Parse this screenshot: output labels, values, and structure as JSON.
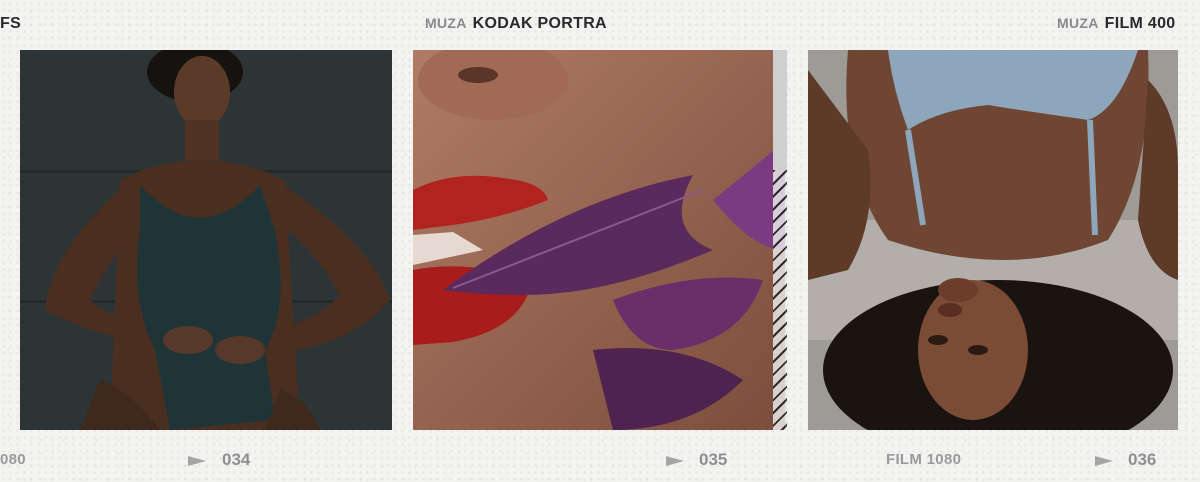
{
  "frames": [
    {
      "top_brand": "",
      "top_title": "FS",
      "bottom_label": "080",
      "frame_number": "034",
      "photo_alt": "woman in dark green swimsuit, hands on hips"
    },
    {
      "top_brand": "MUZA",
      "top_title": "KODAK PORTRA",
      "bottom_label": "",
      "frame_number": "035",
      "photo_alt": "close-up of red lips with purple leaf"
    },
    {
      "top_brand": "MUZA",
      "top_title": "FILM 400",
      "bottom_label": "FILM 1080",
      "frame_number": "036",
      "photo_alt": "woman lying upside down with curly hair"
    }
  ],
  "colors": {
    "background": "#f3f3f1",
    "label_dark": "#2a2a2a",
    "label_gray": "#8f8f8f"
  }
}
